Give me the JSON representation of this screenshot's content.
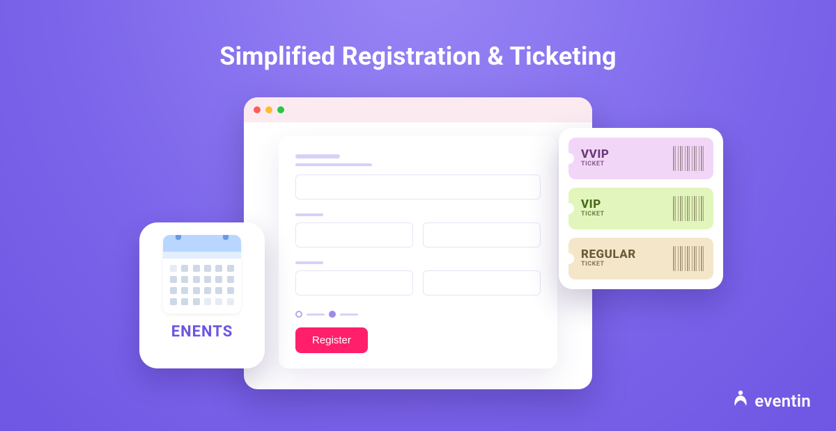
{
  "title": "Simplified Registration & Ticketing",
  "form": {
    "register_label": "Register"
  },
  "events": {
    "card_label": "ENENTS"
  },
  "tickets": {
    "items": [
      {
        "tier": "VVIP",
        "sub": "TICKET",
        "variant": "vvip"
      },
      {
        "tier": "VIP",
        "sub": "TICKET",
        "variant": "vip"
      },
      {
        "tier": "REGULAR",
        "sub": "TICKET",
        "variant": "reg"
      }
    ]
  },
  "brand": {
    "name": "eventin"
  }
}
